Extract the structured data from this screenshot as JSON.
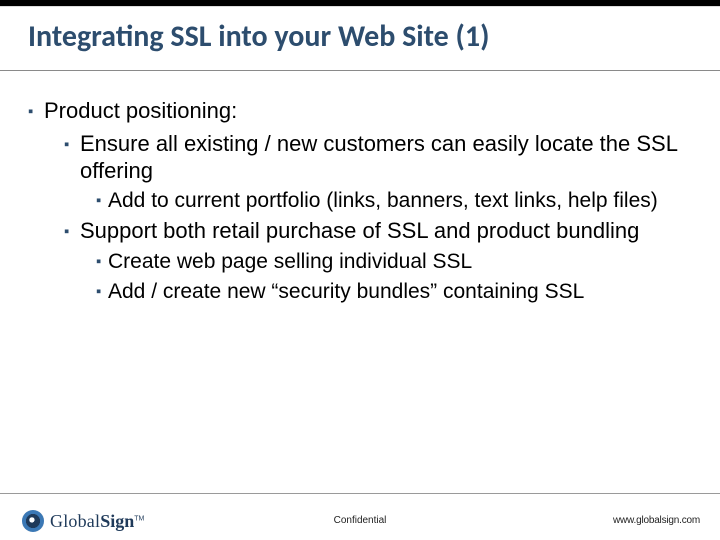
{
  "title": "Integrating SSL into your Web Site (1)",
  "bullets": {
    "l1_0": "Product positioning:",
    "l2_0": "Ensure all existing / new customers can easily locate the SSL offering",
    "l3_0": "Add to current portfolio (links, banners, text links, help files)",
    "l2_1": "Support both retail purchase of SSL and product bundling",
    "l3_1": "Create web page selling individual SSL",
    "l3_2": "Add / create new “security bundles” containing SSL"
  },
  "footer": {
    "logo_word1": "Global",
    "logo_word2": "Sign",
    "tm": "TM",
    "center": "Confidential",
    "url": "www.globalsign.com"
  }
}
